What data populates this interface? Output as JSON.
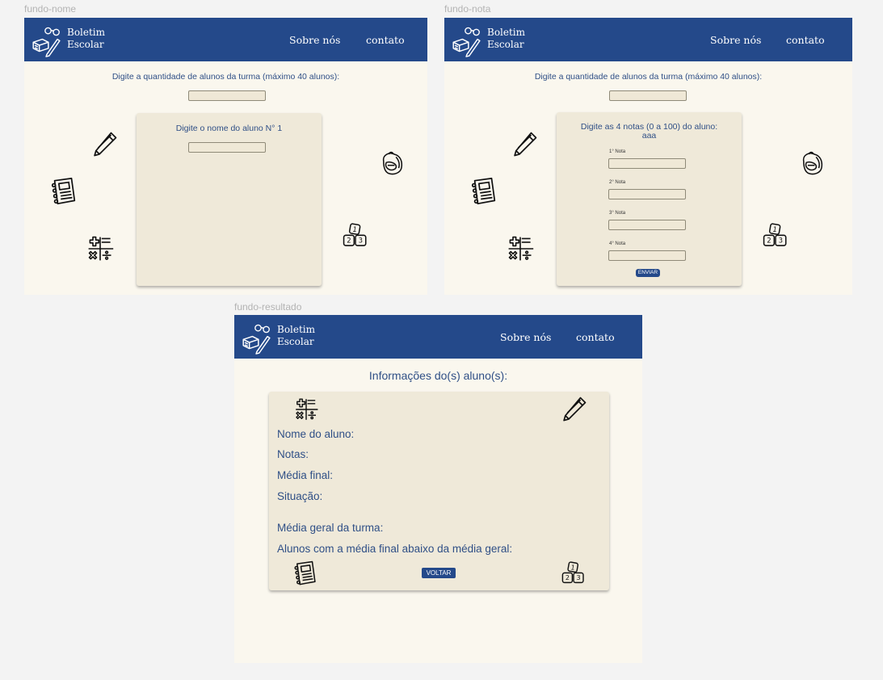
{
  "frames": {
    "nome": {
      "label": "fundo-nome"
    },
    "nota": {
      "label": "fundo-nota"
    },
    "resultado": {
      "label": "fundo-resultado"
    }
  },
  "header": {
    "logo_line1": "Boletim",
    "logo_line2": "Escolar",
    "nav_sobre": "Sobre nós",
    "nav_contato": "contato"
  },
  "form": {
    "quantity_prompt": "Digite a quantidade de alunos da turma (máximo 40 alunos):",
    "name_prompt": "Digite o nome do aluno N° 1",
    "grades_prompt_line1": "Digite as 4 notas (0 a 100) do aluno:",
    "grades_prompt_line2": "aaa",
    "grade_labels": [
      "1° Nota",
      "2° Nota",
      "3° Nota",
      "4° Nota"
    ],
    "send_button": "ENVIAR"
  },
  "result": {
    "title": "Informações do(s) aluno(s):",
    "student_name": "Nome do aluno:",
    "grades": "Notas:",
    "final_average": "Média final:",
    "status": "Situação:",
    "class_average": "Média geral da turma:",
    "below_average": "Alunos com a média final abaixo da média geral:",
    "back_button": "VOLTAR"
  },
  "colors": {
    "header": "#24498a",
    "text": "#2f4f86",
    "background": "#faf7ee",
    "panel": "#efe9d9"
  },
  "icons": [
    "books-icon",
    "glasses-icon",
    "pencil-icon",
    "notebook-icon",
    "math-symbols-icon",
    "backpack-icon",
    "number-blocks-icon"
  ]
}
